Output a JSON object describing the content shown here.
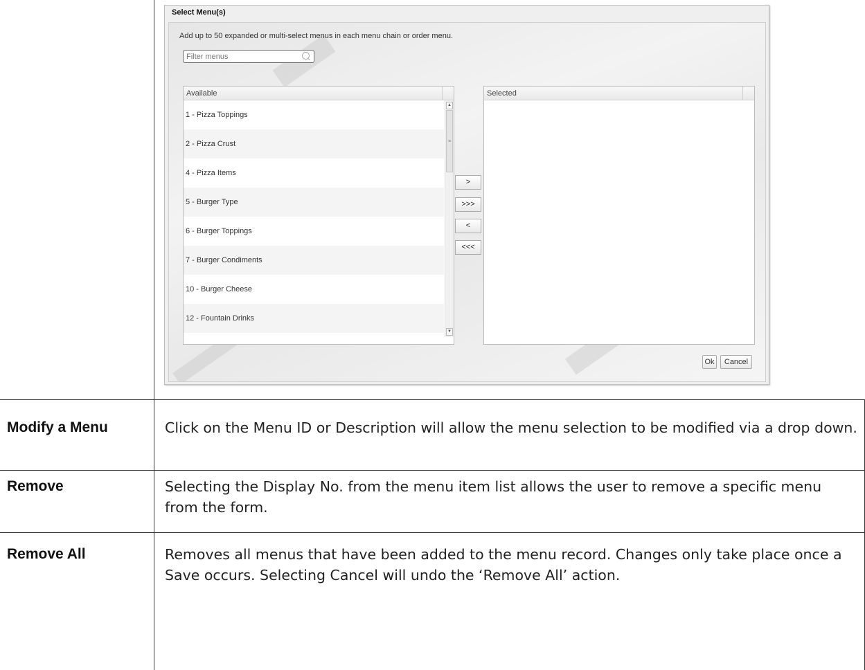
{
  "dialog": {
    "title": "Select Menu(s)",
    "instruction": "Add up to 50 expanded or multi-select menus in each menu chain or order menu.",
    "filter_placeholder": "Filter menus",
    "available_header": "Available",
    "selected_header": "Selected",
    "available_items": [
      "1 - Pizza Toppings",
      "2 - Pizza Crust",
      "4 - Pizza Items",
      "5 - Burger Type",
      "6 - Burger Toppings",
      "7 - Burger Condiments",
      "10 - Burger Cheese",
      "12 - Fountain Drinks"
    ],
    "move_buttons": [
      ">",
      ">>>",
      "<",
      "<<<"
    ],
    "ok_label": "Ok",
    "cancel_label": "Cancel",
    "scroll_grip": "≡",
    "scroll_up": "▲",
    "scroll_down": "▼"
  },
  "rows": [
    {
      "term": "Modify a Menu",
      "description": "Click on the Menu ID or Description will allow the menu selection to be modified via a drop down."
    },
    {
      "term": "Remove",
      "description": "Selecting the Display No. from the menu item list allows the user to remove a specific menu from the form."
    },
    {
      "term": "Remove All",
      "description": "Removes all menus that have been added to the menu record. Changes only take place once a Save occurs. Selecting Cancel will undo the ‘Remove All’ action."
    }
  ]
}
